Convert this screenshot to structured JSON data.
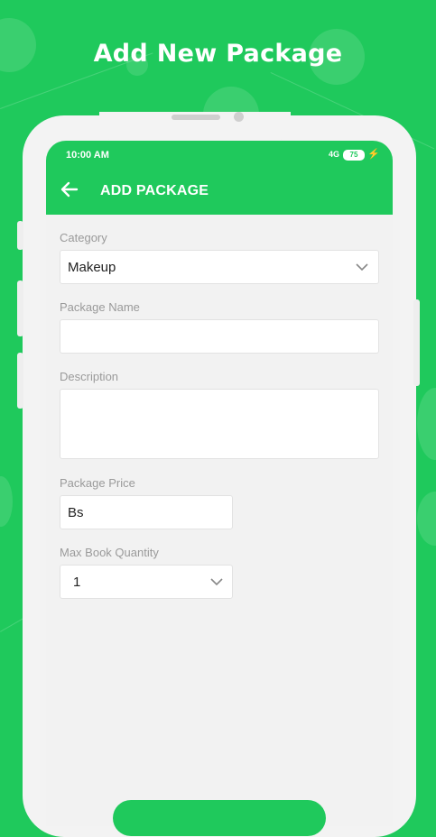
{
  "headline": "Add New Package",
  "status_bar": {
    "time": "10:00 AM",
    "signal": "4G",
    "battery": "75"
  },
  "app_bar": {
    "title": "ADD PACKAGE",
    "back_icon": "arrow-left-icon"
  },
  "form": {
    "category": {
      "label": "Category",
      "value": "Makeup"
    },
    "package_name": {
      "label": "Package Name",
      "value": ""
    },
    "description": {
      "label": "Description",
      "value": ""
    },
    "package_price": {
      "label": "Package Price",
      "value": "Bs"
    },
    "max_book_quantity": {
      "label": "Max Book Quantity",
      "value": "1"
    }
  },
  "colors": {
    "accent": "#1fc95c",
    "screen_bg": "#f2f2f2",
    "label": "#9a9a9a"
  }
}
